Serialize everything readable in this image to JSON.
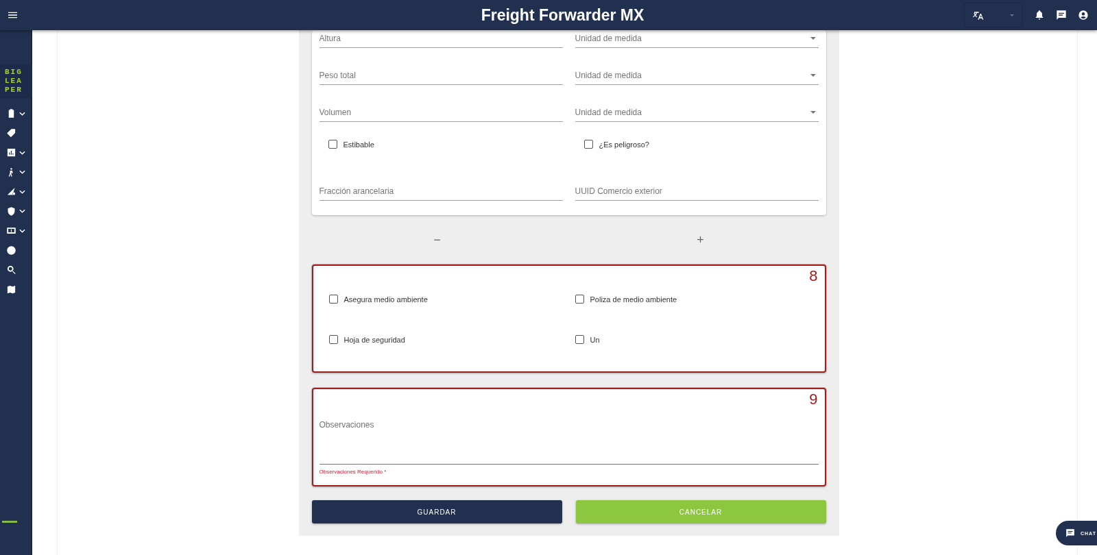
{
  "header": {
    "title": "Freight Forwarder MX"
  },
  "sidebar": {
    "logo": "BIG LEA PER",
    "items": [
      {
        "expandable": true
      },
      {
        "expandable": false
      },
      {
        "expandable": true
      },
      {
        "expandable": true
      },
      {
        "expandable": true
      },
      {
        "expandable": true
      },
      {
        "expandable": true
      },
      {
        "expandable": false
      },
      {
        "expandable": false
      },
      {
        "expandable": false
      }
    ]
  },
  "cargo_card": {
    "measure_rows": [
      {
        "placeholder": "Altura",
        "unit_placeholder": "Unidad de medida"
      },
      {
        "placeholder": "Peso total",
        "unit_placeholder": "Unidad de medida"
      },
      {
        "placeholder": "Volumen",
        "unit_placeholder": "Unidad de medida"
      }
    ],
    "checks": [
      {
        "label": "Estibable",
        "checked": false
      },
      {
        "label": "¿Es peligroso?",
        "checked": false
      }
    ],
    "text_fields": [
      {
        "placeholder": "Fracción arancelaria"
      },
      {
        "placeholder": "UUID Comercio exterior"
      }
    ]
  },
  "item_controls": {
    "remove": "−",
    "add": "+"
  },
  "environment_section": {
    "annotation": "8",
    "checks": [
      {
        "label": "Asegura medio ambiente",
        "checked": false
      },
      {
        "label": "Poliza de medio ambiente",
        "checked": false
      },
      {
        "label": "Hoja de seguridad",
        "checked": false
      },
      {
        "label": "Un",
        "checked": false
      }
    ]
  },
  "notes_section": {
    "annotation": "9",
    "placeholder": "Observaciones",
    "error": "Observaciones Requerido *"
  },
  "buttons": [
    {
      "label": "GUARDAR",
      "kind": "primary"
    },
    {
      "label": "CANCELAR",
      "kind": "secondary"
    }
  ],
  "chat": {
    "label": "CHAT"
  }
}
